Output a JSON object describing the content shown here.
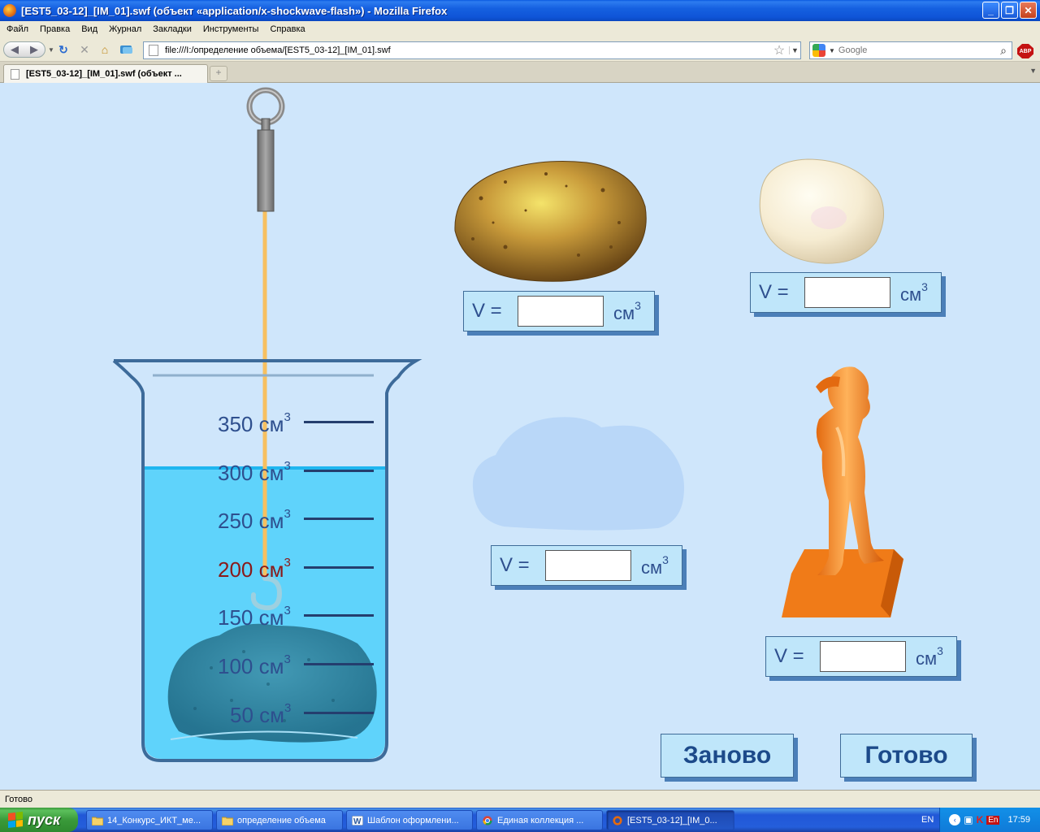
{
  "window": {
    "title": "[EST5_03-12]_[IM_01].swf (объект «application/x-shockwave-flash») - Mozilla Firefox",
    "buttons": {
      "minimize": "_",
      "maximize": "❐",
      "close": "✕"
    }
  },
  "menu": [
    "Файл",
    "Правка",
    "Вид",
    "Журнал",
    "Закладки",
    "Инструменты",
    "Справка"
  ],
  "nav": {
    "url": "file:///I:/определение объема/[EST5_03-12]_[IM_01].swf",
    "search_placeholder": "Google",
    "adblock_label": "ABP"
  },
  "tabs": [
    {
      "label": "[EST5_03-12]_[IM_01].swf (объект ..."
    }
  ],
  "flash": {
    "beaker": {
      "graduations": [
        {
          "value": "350",
          "unit": "см",
          "exp": "3"
        },
        {
          "value": "300",
          "unit": "см",
          "exp": "3"
        },
        {
          "value": "250",
          "unit": "см",
          "exp": "3"
        },
        {
          "value": "200",
          "unit": "см",
          "exp": "3",
          "highlight": true
        },
        {
          "value": "150",
          "unit": "см",
          "exp": "3"
        },
        {
          "value": "100",
          "unit": "см",
          "exp": "3"
        },
        {
          "value": "50",
          "unit": "см",
          "exp": "3"
        }
      ],
      "water_level_cm3": 300
    },
    "volume_fields": {
      "label": "V =",
      "unit": "см",
      "exp": "3",
      "potato": "",
      "egg": "",
      "stone": "",
      "statue": ""
    },
    "buttons": {
      "restart": "Заново",
      "done": "Готово"
    },
    "colors": {
      "background": "#cfe6fb",
      "panel": "#bfe6fa",
      "water": "#5fd3fb",
      "text": "#2e4f8e",
      "highlight": "#8a1a1a"
    }
  },
  "status": {
    "text": "Готово"
  },
  "taskbar": {
    "start": "пуск",
    "tasks": [
      {
        "label": "14_Конкурс_ИКТ_ме...",
        "icon": "folder-icon"
      },
      {
        "label": "определение объема",
        "icon": "folder-icon"
      },
      {
        "label": "Шаблон оформлени...",
        "icon": "word-icon"
      },
      {
        "label": "Единая коллекция ...",
        "icon": "chrome-icon"
      },
      {
        "label": "[EST5_03-12]_[IM_0...",
        "icon": "firefox-icon",
        "active": true
      }
    ],
    "lang": "EN",
    "tray_lang": "En",
    "clock": "17:59"
  }
}
